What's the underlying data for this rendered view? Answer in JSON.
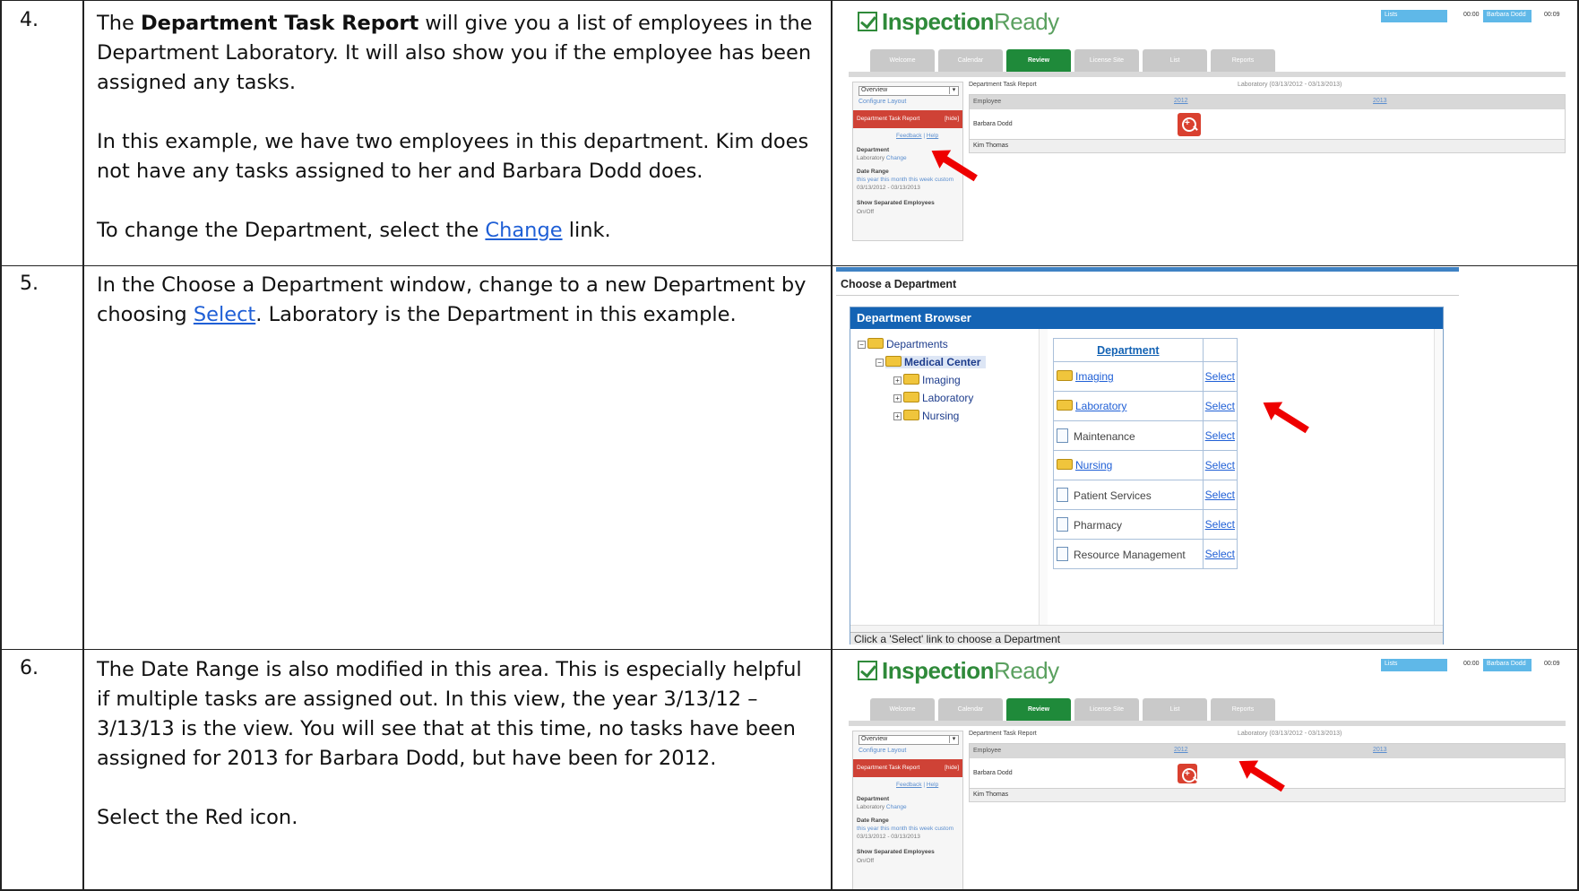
{
  "rows": [
    {
      "number": "4.",
      "para1_prefix": "The ",
      "para1_bold": "Department Task Report",
      "para1_suffix": " will give you a list of employees in the Department Laboratory.  It will also show you if the employee has been assigned any tasks.",
      "para2": "In this example, we have two employees in this department.  Kim does not have any tasks assigned to her and Barbara Dodd does.",
      "para3_prefix": "To change the Department, select the ",
      "para3_link": "Change",
      "para3_suffix": " link."
    },
    {
      "number": "5.",
      "para1_prefix": "In the Choose a Department window, change to a new Department by choosing ",
      "para1_link": "Select",
      "para1_suffix": ". Laboratory is the Department in this example."
    },
    {
      "number": "6.",
      "para1": "The Date Range is also modified in this area. This is especially helpful if multiple tasks are assigned out.  In this view, the year 3/13/12 – 3/13/13 is the view.  You will see that at this time, no tasks have been assigned for 2013 for Barbara Dodd, but have been for 2012.",
      "para2": "Select the Red icon."
    }
  ],
  "app": {
    "logo_main": "Inspection",
    "logo_accent": "Ready",
    "top_links": [
      "Lists",
      "00:00",
      "Barbara Dodd",
      "00:09"
    ],
    "tabs": [
      "Welcome",
      "Calendar",
      "Review",
      "License Site",
      "List",
      "Reports"
    ],
    "sidebar": {
      "view_select": "Overview",
      "configure_link": "Configure Layout",
      "report_title": "Department Task Report",
      "report_badge": "[hide]",
      "feedback": "Feedback",
      "help": "Help",
      "department_label": "Department",
      "department_value": "Laboratory",
      "department_change": "Change",
      "date_range_label": "Date Range",
      "date_shortcuts": "this year  this month  this week  custom",
      "date_value": "03/13/2012 - 03/13/2013",
      "separated_label": "Show Separated Employees",
      "separated_value": "On/Off"
    },
    "report": {
      "title": "Department Task Report",
      "subtitle": "Laboratory (03/13/2012 - 03/13/2013)",
      "col_employee": "Employee",
      "col_year1": "2012",
      "col_year2": "2013",
      "employees": [
        "Barbara Dodd",
        "Kim Thomas"
      ]
    }
  },
  "dialog": {
    "title": "Choose a Department",
    "browser_title": "Department Browser",
    "tree": {
      "root": "Departments",
      "center": "Medical Center",
      "children": [
        "Imaging",
        "Laboratory",
        "Nursing"
      ]
    },
    "table_header": "Department",
    "select_label": "Select",
    "departments": [
      {
        "name": "Imaging",
        "linked": true,
        "folder": true
      },
      {
        "name": "Laboratory",
        "linked": true,
        "folder": true
      },
      {
        "name": "Maintenance",
        "linked": false,
        "folder": false
      },
      {
        "name": "Nursing",
        "linked": true,
        "folder": true
      },
      {
        "name": "Patient Services",
        "linked": false,
        "folder": false
      },
      {
        "name": "Pharmacy",
        "linked": false,
        "folder": false
      },
      {
        "name": "Resource Management",
        "linked": false,
        "folder": false
      }
    ],
    "status": "Click a 'Select' link to choose a Department"
  }
}
